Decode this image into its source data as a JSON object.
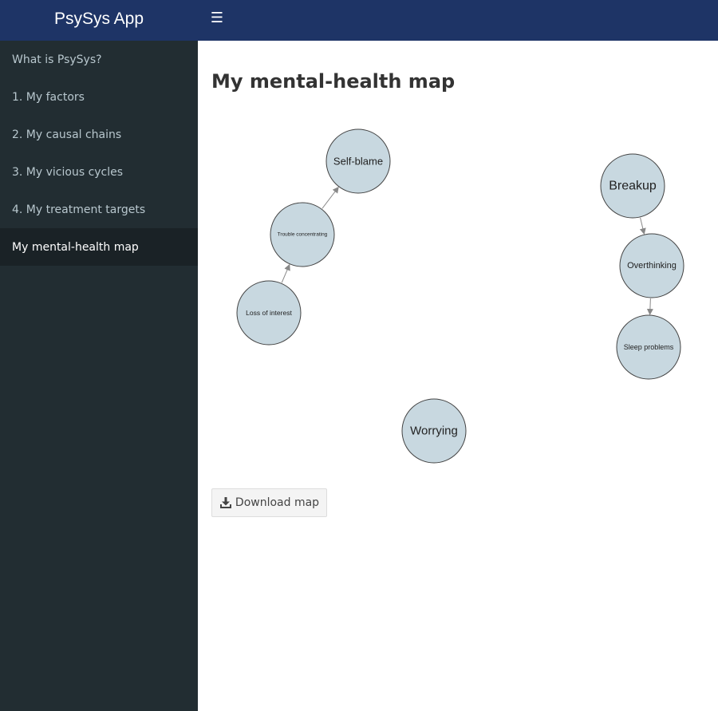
{
  "app": {
    "title": "PsySys App"
  },
  "header": {
    "menu_icon": "hamburger-icon"
  },
  "sidebar": {
    "items": [
      {
        "label": "What is PsySys?",
        "active": false
      },
      {
        "label": "1. My factors",
        "active": false
      },
      {
        "label": "2. My causal chains",
        "active": false
      },
      {
        "label": "3. My vicious cycles",
        "active": false
      },
      {
        "label": "4. My treatment targets",
        "active": false
      },
      {
        "label": "My mental-health map",
        "active": true
      }
    ]
  },
  "main": {
    "title": "My mental-health map",
    "map": {
      "node_fill": "#c8d8e0",
      "node_stroke": "#444444",
      "edge_color": "#888888",
      "nodes": [
        {
          "id": "self-blame",
          "label": "Self-blame"
        },
        {
          "id": "trouble-concentrating",
          "label": "Trouble concentrating"
        },
        {
          "id": "loss-of-interest",
          "label": "Loss of interest"
        },
        {
          "id": "breakup",
          "label": "Breakup"
        },
        {
          "id": "overthinking",
          "label": "Overthinking"
        },
        {
          "id": "sleep-problems",
          "label": "Sleep problems"
        },
        {
          "id": "worrying",
          "label": "Worrying"
        }
      ],
      "edges": [
        {
          "from": "loss-of-interest",
          "to": "trouble-concentrating"
        },
        {
          "from": "trouble-concentrating",
          "to": "self-blame"
        },
        {
          "from": "breakup",
          "to": "overthinking"
        },
        {
          "from": "overthinking",
          "to": "sleep-problems"
        }
      ]
    },
    "download_label": "Download map",
    "download_icon": "download-icon"
  }
}
